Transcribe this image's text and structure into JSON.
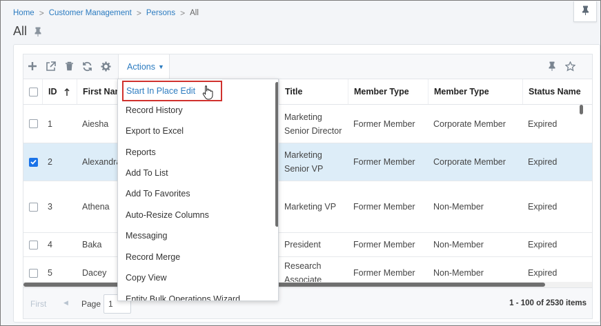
{
  "breadcrumb": {
    "items": [
      "Home",
      "Customer Management",
      "Persons"
    ],
    "current": "All"
  },
  "page": {
    "title": "All"
  },
  "toolbar": {
    "actions_label": "Actions"
  },
  "columns": [
    "ID",
    "First Name",
    "Title",
    "Member Type",
    "Member Type",
    "Status Name"
  ],
  "rows": [
    {
      "id": "1",
      "first_name": "Aiesha",
      "title": [
        "Marketing",
        "Senior Director"
      ],
      "member_type_1": "Former Member",
      "member_type_2": "Corporate Member",
      "status": "Expired",
      "selected": false
    },
    {
      "id": "2",
      "first_name": "Alexandra",
      "title": [
        "Marketing",
        "Senior VP"
      ],
      "member_type_1": "Former Member",
      "member_type_2": "Corporate Member",
      "status": "Expired",
      "selected": true
    },
    {
      "id": "3",
      "first_name": "Athena",
      "title": [
        "Marketing VP",
        ""
      ],
      "member_type_1": "Former Member",
      "member_type_2": "Non-Member",
      "status": "Expired",
      "selected": false
    },
    {
      "id": "4",
      "first_name": "Baka",
      "title": [
        "President",
        ""
      ],
      "member_type_1": "Former Member",
      "member_type_2": "Non-Member",
      "status": "Expired",
      "selected": false
    },
    {
      "id": "5",
      "first_name": "Dacey",
      "title": [
        "Research",
        "Associate"
      ],
      "member_type_1": "Former Member",
      "member_type_2": "Non-Member",
      "status": "Expired",
      "selected": false
    }
  ],
  "actions_menu": [
    "Start In Place Edit",
    "Record History",
    "Export to Excel",
    "Reports",
    "Add To List",
    "Add To Favorites",
    "Auto-Resize Columns",
    "Messaging",
    "Record Merge",
    "Copy View",
    "Entity Bulk Operations Wizard"
  ],
  "pager": {
    "first_label": "First",
    "page_label": "Page",
    "page_value": "1",
    "count": "1 - 100 of 2530 items"
  },
  "colors": {
    "link": "#2b7bc0",
    "selected_row": "#ddedf8",
    "highlight_border": "#d0312d",
    "checkbox_checked": "#1a73e8"
  },
  "icons": [
    "add-icon",
    "external-link-icon",
    "trash-icon",
    "refresh-icon",
    "gear-icon",
    "pin-icon",
    "star-icon",
    "sort-asc-icon",
    "hand-cursor-icon"
  ]
}
